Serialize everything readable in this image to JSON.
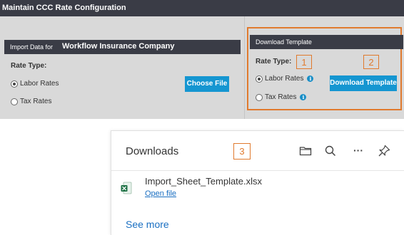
{
  "header": {
    "title": "Maintain CCC Rate Configuration"
  },
  "import_section": {
    "heading_prefix": "Import Data for",
    "company": "Workflow Insurance Company",
    "rate_type_label": "Rate Type:",
    "options": [
      {
        "label": "Labor Rates",
        "selected": true
      },
      {
        "label": "Tax Rates",
        "selected": false
      }
    ],
    "choose_file_label": "Choose File"
  },
  "download_section": {
    "heading": "Download Template",
    "rate_type_label": "Rate Type:",
    "options": [
      {
        "label": "Labor Rates",
        "selected": true,
        "info_icon": "info-icon"
      },
      {
        "label": "Tax Rates",
        "selected": false,
        "info_icon": "info-icon"
      }
    ],
    "download_button_label": "Download Template",
    "info_glyph": "i"
  },
  "annotations": [
    "1",
    "2",
    "3"
  ],
  "downloads_panel": {
    "title": "Downloads",
    "toolbar_icons": [
      "folder-icon",
      "search-icon",
      "more-icon",
      "pin-icon"
    ],
    "more_glyph": "···",
    "item": {
      "file_name": "Import_Sheet_Template.xlsx",
      "action": "Open file",
      "icon": "excel-file-icon"
    },
    "see_more": "See more"
  },
  "colors": {
    "header_bg": "#3a3c46",
    "panel_bg": "#d9d9d9",
    "button_bg": "#1596d1",
    "highlight": "#e07a2e",
    "link": "#1a6fc2"
  }
}
